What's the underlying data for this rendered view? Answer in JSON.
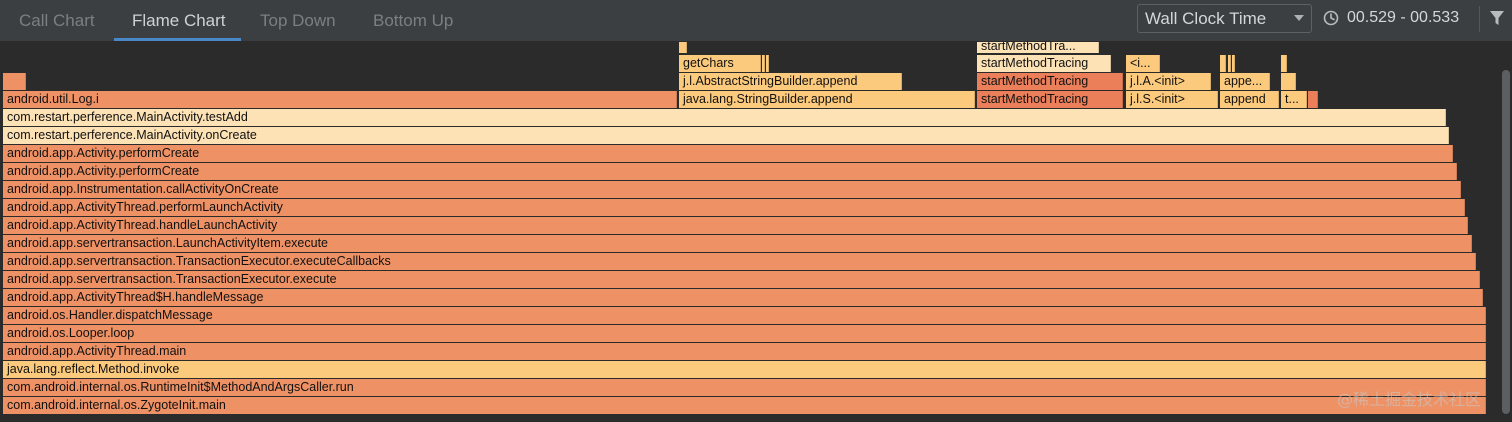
{
  "tabs": [
    {
      "label": "Call Chart"
    },
    {
      "label": "Flame Chart"
    },
    {
      "label": "Top Down"
    },
    {
      "label": "Bottom Up"
    }
  ],
  "active_tab": "Flame Chart",
  "clock_mode": {
    "selected": "Wall Clock Time"
  },
  "time_range": "00.529 - 00.533",
  "watermark": "@稀土掘金技术社区",
  "colors": {
    "toolbar_bg": "#3c3f41",
    "chart_bg": "#2b2b2b",
    "accent": "#4a88c7",
    "frame_orange": "#ee9266",
    "frame_light": "#fde2b6",
    "frame_yellow": "#fcca7c",
    "frame_deep": "#ea7f5a"
  },
  "flame": {
    "stack": [
      "com.android.internal.os.ZygoteInit.main",
      "com.android.internal.os.RuntimeInit$MethodAndArgsCaller.run",
      "java.lang.reflect.Method.invoke",
      "android.app.ActivityThread.main",
      "android.os.Looper.loop",
      "android.os.Handler.dispatchMessage",
      "android.app.ActivityThread$H.handleMessage",
      "android.app.servertransaction.TransactionExecutor.execute",
      "android.app.servertransaction.TransactionExecutor.executeCallbacks",
      "android.app.servertransaction.LaunchActivityItem.execute",
      "android.app.ActivityThread.handleLaunchActivity",
      "android.app.ActivityThread.performLaunchActivity",
      "android.app.Instrumentation.callActivityOnCreate",
      "android.app.Activity.performCreate",
      "android.app.Activity.performCreate",
      "com.restart.perference.MainActivity.onCreate",
      "com.restart.perference.MainActivity.testAdd"
    ],
    "children_level_1": [
      "android.util.Log.i",
      "java.lang.StringBuilder.append",
      "startMethodTracing",
      "j.l.S.<init>",
      "append",
      "t..."
    ],
    "children_level_2": [
      "j.l.AbstractStringBuilder.append",
      "startMethodTracing",
      "j.l.A.<init>",
      "appe..."
    ],
    "children_level_3": [
      "getChars",
      "startMethodTracing",
      "<i..."
    ],
    "children_level_4": [
      "startMethodTra..."
    ]
  }
}
